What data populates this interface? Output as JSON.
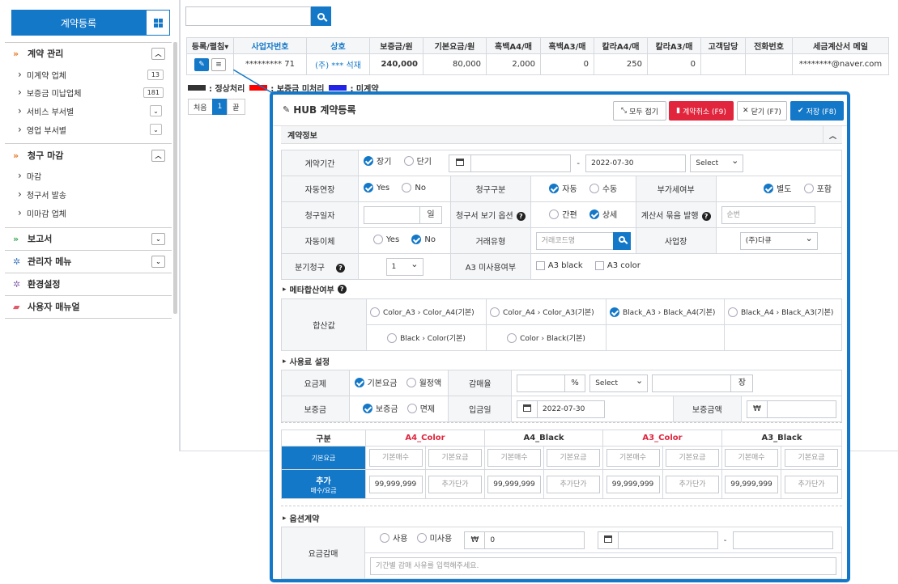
{
  "sidebar": {
    "title": "계약등록",
    "sections": [
      {
        "label": "계약 관리",
        "items": [
          {
            "label": "미계약 업체",
            "count": "13"
          },
          {
            "label": "보증금 미납업체",
            "count": "181"
          },
          {
            "label": "서비스 부서별"
          },
          {
            "label": "영업 부서별"
          }
        ]
      },
      {
        "label": "청구 마감",
        "items": [
          {
            "label": "마감"
          },
          {
            "label": "청구서 발송"
          },
          {
            "label": "미마감 업체"
          }
        ]
      },
      {
        "label": "보고서"
      },
      {
        "label": "관리자 메뉴"
      },
      {
        "label": "환경설정"
      },
      {
        "label": "사용자 매뉴얼"
      }
    ]
  },
  "list": {
    "headers": [
      "등록/펼침▾",
      "사업자번호",
      "상호",
      "보증금/원",
      "기본요금/원",
      "흑백A4/매",
      "흑백A3/매",
      "칼라A4/매",
      "칼라A3/매",
      "고객담당",
      "전화번호",
      "세금계산서 메일"
    ],
    "row": [
      "********* 71",
      "(주) *** 석재",
      "240,000",
      "80,000",
      "2,000",
      "0",
      "250",
      "0",
      "",
      "",
      "********@naver.com"
    ],
    "legend": [
      {
        "label": ": 정상처리",
        "color": "#333333"
      },
      {
        "label": ": 보증금 미처리",
        "color": "#ff0000"
      },
      {
        "label": ": 미계약",
        "color": "#2323e6"
      }
    ],
    "pager": [
      "처음",
      "1",
      "끝"
    ]
  },
  "modal": {
    "title": "HUB 계약등록",
    "buttons": {
      "collapse": "모두 접기",
      "cancel": "계약취소 (F9)",
      "close": "닫기 (F7)",
      "save": "저장 (F8)"
    },
    "section_contract": "계약정보",
    "period": {
      "label": "계약기간",
      "long": "장기",
      "short": "단기",
      "end": "2022-07-30",
      "select": "Select"
    },
    "auto_renew": {
      "label": "자동연장",
      "yes": "Yes",
      "no": "No"
    },
    "bill_type": {
      "label": "청구구분",
      "auto": "자동",
      "manual": "수동"
    },
    "vat": {
      "label": "부가세여부",
      "separate": "별도",
      "include": "포함"
    },
    "bill_day": {
      "label": "청구일자",
      "unit": "일"
    },
    "bill_view": {
      "label": "청구서 보기 옵션",
      "simple": "간편",
      "detail": "상세"
    },
    "invoice_bundle": {
      "label": "계산서 묶음 발행",
      "placeholder": "순번"
    },
    "auto_transfer": {
      "label": "자동이체",
      "yes": "Yes",
      "no": "No"
    },
    "trade_type": {
      "label": "거래유형",
      "placeholder": "거래코드명"
    },
    "workplace": {
      "label": "사업장",
      "value": "(주)다큐"
    },
    "quarter": {
      "label": "분기청구",
      "value": "1"
    },
    "a3_unused": {
      "label": "A3 미사용여부",
      "black": "A3 black",
      "color": "A3 color"
    },
    "meta_head": "메타합산여부",
    "sum": {
      "label": "합산값",
      "opts": [
        "Color_A3",
        "Color_A4(기본)",
        "Color_A4",
        "Color_A3(기본)",
        "Black_A3",
        "Black_A4(기본)",
        "Black_A4",
        "Black_A3(기본)",
        "Black",
        "Color(기본)",
        "Color",
        "Black(기본)"
      ]
    },
    "usage_head": "사용료 설정",
    "plan": {
      "label": "요금제",
      "basic": "기본요금",
      "monthly": "월정액"
    },
    "discount": {
      "label": "감매율",
      "unit": "%",
      "select": "Select",
      "unit2": "장"
    },
    "deposit": {
      "label": "보증금",
      "deposit": "보증금",
      "exempt": "면제"
    },
    "pay_date": {
      "label": "입금일",
      "value": "2022-07-30"
    },
    "deposit_amt": {
      "label": "보증금액",
      "currency": "₩"
    },
    "price": {
      "col0": "구분",
      "cols": [
        "A4_Color",
        "A4_Black",
        "A3_Color",
        "A3_Black"
      ],
      "row1": "기본요금",
      "row2a": "추가",
      "row2b": "매수/요금",
      "ph_count": "기본매수",
      "ph_fee": "기본요금",
      "count_val": "99,999,999",
      "ph_add": "추가단가"
    },
    "option_head": "옵션계약",
    "fee_discount": {
      "label": "요금감매",
      "use": "사용",
      "unused": "미사용",
      "currency": "₩",
      "value": "0",
      "reason_placeholder": "기간별 감매 사유를 입력해주세요."
    }
  }
}
